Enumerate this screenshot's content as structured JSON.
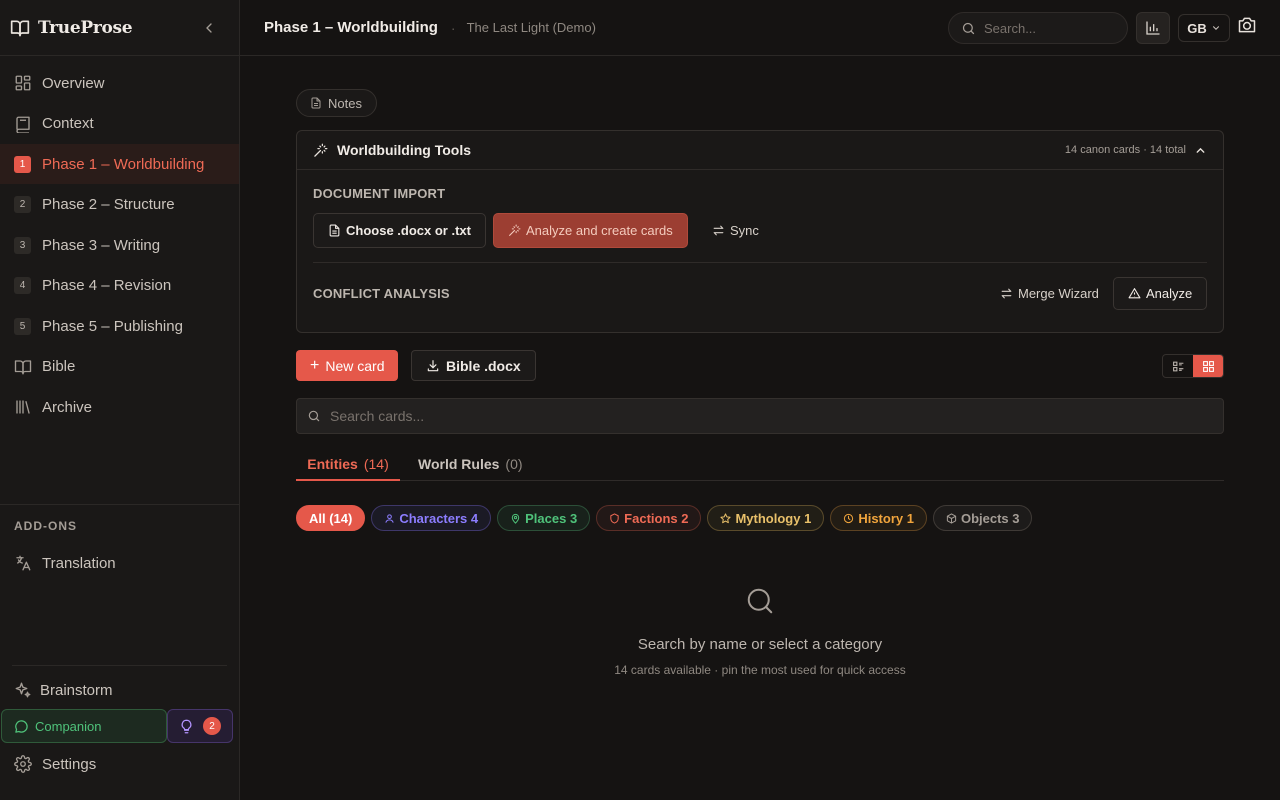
{
  "app": {
    "brand": "TrueProse"
  },
  "sidebar": {
    "items": [
      {
        "label": "Overview"
      },
      {
        "label": "Context"
      },
      {
        "number": "1",
        "label": "Phase 1 – Worldbuilding"
      },
      {
        "number": "2",
        "label": "Phase 2 – Structure"
      },
      {
        "number": "3",
        "label": "Phase 3 – Writing"
      },
      {
        "number": "4",
        "label": "Phase 4 – Revision"
      },
      {
        "number": "5",
        "label": "Phase 5 – Publishing"
      },
      {
        "label": "Bible"
      },
      {
        "label": "Archive"
      }
    ],
    "active_index": 2,
    "addons_title": "ADD-ONS",
    "addons": [
      {
        "label": "Translation"
      }
    ],
    "brainstorm_label": "Brainstorm",
    "companion_label": "Companion",
    "ideas_badge": "2",
    "settings_label": "Settings"
  },
  "header": {
    "title": "Phase 1 – Worldbuilding",
    "separator": "·",
    "project": "The Last Light (Demo)",
    "search_placeholder": "Search...",
    "language": "GB"
  },
  "main": {
    "notes_label": "Notes",
    "tools": {
      "title": "Worldbuilding Tools",
      "meta": "14 canon cards · 14 total",
      "document_import_label": "DOCUMENT IMPORT",
      "choose_file_label": "Choose .docx or .txt",
      "analyze_create_label": "Analyze and create cards",
      "sync_label": "Sync",
      "conflict_label": "CONFLICT ANALYSIS",
      "merge_label": "Merge Wizard",
      "analyze_label": "Analyze"
    },
    "new_card_label": "New card",
    "bible_docx_label": "Bible .docx",
    "card_search_placeholder": "Search cards...",
    "tabs": [
      {
        "label": "Entities",
        "count": "(14)"
      },
      {
        "label": "World Rules",
        "count": "(0)"
      }
    ],
    "chips": [
      {
        "label": "All (14)"
      },
      {
        "label": "Characters 4"
      },
      {
        "label": "Places 3"
      },
      {
        "label": "Factions 2"
      },
      {
        "label": "Mythology 1"
      },
      {
        "label": "History 1"
      },
      {
        "label": "Objects 3"
      }
    ],
    "empty": {
      "message": "Search by name or select a category",
      "hint": "14 cards available · pin the most used for quick access"
    }
  },
  "colors": {
    "accent": "#e5584a",
    "background": "#151312",
    "sidebar_bg": "#1a1817",
    "characters": "#8c7dff",
    "places": "#4fc27a",
    "factions": "#ef6a55",
    "mythology": "#e8c06a",
    "history": "#f0a43c"
  }
}
